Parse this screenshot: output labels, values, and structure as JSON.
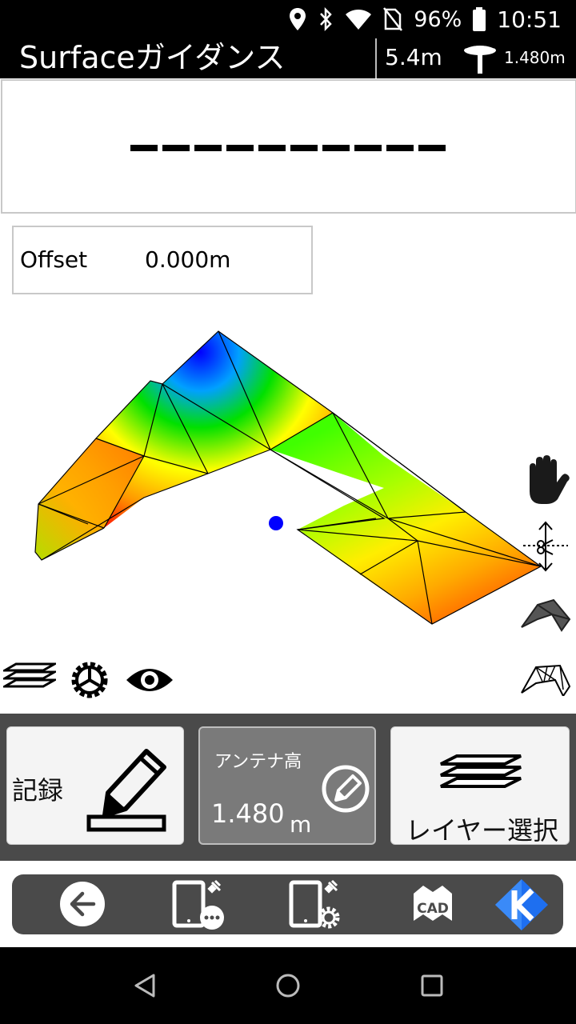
{
  "status": {
    "battery": "96%",
    "time": "10:51"
  },
  "title_bar": {
    "title": "Surfaceガイダンス",
    "distance": "5.4m",
    "antenna_height": "1.480m"
  },
  "guidance": {
    "value_display": "----------"
  },
  "offset": {
    "label": "Offset",
    "value": "0.000m"
  },
  "actions": {
    "record_label": "記録",
    "antenna_title": "アンテナ高",
    "antenna_value": "1.480",
    "antenna_unit": "m",
    "layer_label": "レイヤー選択"
  },
  "nav": {
    "cad_label": "CAD"
  },
  "colors": {
    "bar": "#000000",
    "panel": "#4a4a4a",
    "antenna_button": "#7a7a7a",
    "position_marker": "#0000ff",
    "nav_brand": "#1e6ff0"
  },
  "icons": [
    "location-icon",
    "bluetooth-icon",
    "wifi-icon",
    "no-sim-icon",
    "battery-icon",
    "prism-icon",
    "hand-pan-icon",
    "cut-fill-icon",
    "surface-solid-icon",
    "surface-wireframe-icon",
    "layers-icon",
    "settings-gear-icon",
    "eye-icon",
    "pencil-icon",
    "edit-circle-icon",
    "back-arrow-icon",
    "device-more-icon",
    "device-settings-icon",
    "cad-icon",
    "k-logo-icon"
  ]
}
